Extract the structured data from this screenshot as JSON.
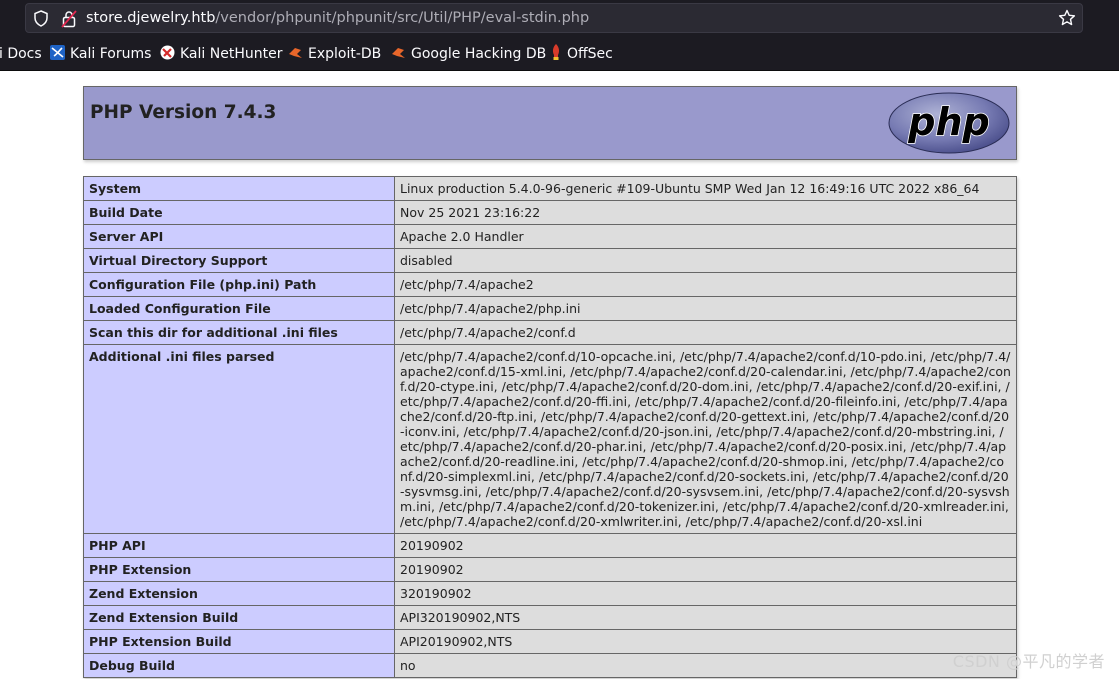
{
  "browser": {
    "url_host": "store.djewelry.htb",
    "url_path": "/vendor/phpunit/phpunit/src/Util/PHP/eval-stdin.php",
    "bookmarks": [
      {
        "label": "i Docs",
        "icon": "kali-docs-icon"
      },
      {
        "label": "Kali Forums",
        "icon": "kali-forums-icon"
      },
      {
        "label": "Kali NetHunter",
        "icon": "kali-nethunter-icon"
      },
      {
        "label": "Exploit-DB",
        "icon": "exploit-db-icon"
      },
      {
        "label": "Google Hacking DB",
        "icon": "ghdb-icon"
      },
      {
        "label": "OffSec",
        "icon": "offsec-icon"
      }
    ]
  },
  "phpinfo": {
    "title": "PHP Version 7.4.3",
    "logo_text": "php",
    "rows": [
      {
        "key": "System",
        "value": "Linux production 5.4.0-96-generic #109-Ubuntu SMP Wed Jan 12 16:49:16 UTC 2022 x86_64"
      },
      {
        "key": "Build Date",
        "value": "Nov 25 2021 23:16:22"
      },
      {
        "key": "Server API",
        "value": "Apache 2.0 Handler"
      },
      {
        "key": "Virtual Directory Support",
        "value": "disabled"
      },
      {
        "key": "Configuration File (php.ini) Path",
        "value": "/etc/php/7.4/apache2"
      },
      {
        "key": "Loaded Configuration File",
        "value": "/etc/php/7.4/apache2/php.ini"
      },
      {
        "key": "Scan this dir for additional .ini files",
        "value": "/etc/php/7.4/apache2/conf.d"
      },
      {
        "key": "Additional .ini files parsed",
        "value": "/etc/php/7.4/apache2/conf.d/10-opcache.ini, /etc/php/7.4/apache2/conf.d/10-pdo.ini, /etc/php/7.4/apache2/conf.d/15-xml.ini, /etc/php/7.4/apache2/conf.d/20-calendar.ini, /etc/php/7.4/apache2/conf.d/20-ctype.ini, /etc/php/7.4/apache2/conf.d/20-dom.ini, /etc/php/7.4/apache2/conf.d/20-exif.ini, /etc/php/7.4/apache2/conf.d/20-ffi.ini, /etc/php/7.4/apache2/conf.d/20-fileinfo.ini, /etc/php/7.4/apache2/conf.d/20-ftp.ini, /etc/php/7.4/apache2/conf.d/20-gettext.ini, /etc/php/7.4/apache2/conf.d/20-iconv.ini, /etc/php/7.4/apache2/conf.d/20-json.ini, /etc/php/7.4/apache2/conf.d/20-mbstring.ini, /etc/php/7.4/apache2/conf.d/20-phar.ini, /etc/php/7.4/apache2/conf.d/20-posix.ini, /etc/php/7.4/apache2/conf.d/20-readline.ini, /etc/php/7.4/apache2/conf.d/20-shmop.ini, /etc/php/7.4/apache2/conf.d/20-simplexml.ini, /etc/php/7.4/apache2/conf.d/20-sockets.ini, /etc/php/7.4/apache2/conf.d/20-sysvmsg.ini, /etc/php/7.4/apache2/conf.d/20-sysvsem.ini, /etc/php/7.4/apache2/conf.d/20-sysvshm.ini, /etc/php/7.4/apache2/conf.d/20-tokenizer.ini, /etc/php/7.4/apache2/conf.d/20-xmlreader.ini, /etc/php/7.4/apache2/conf.d/20-xmlwriter.ini, /etc/php/7.4/apache2/conf.d/20-xsl.ini"
      },
      {
        "key": "PHP API",
        "value": "20190902"
      },
      {
        "key": "PHP Extension",
        "value": "20190902"
      },
      {
        "key": "Zend Extension",
        "value": "320190902"
      },
      {
        "key": "Zend Extension Build",
        "value": "API320190902,NTS"
      },
      {
        "key": "PHP Extension Build",
        "value": "API20190902,NTS"
      },
      {
        "key": "Debug Build",
        "value": "no"
      }
    ]
  },
  "watermark": "CSDN @平凡的学者",
  "colors": {
    "header_bg": "#9999cc",
    "key_bg": "#ccccff",
    "value_bg": "#dddddd",
    "chrome_bg": "#1c1b22"
  }
}
